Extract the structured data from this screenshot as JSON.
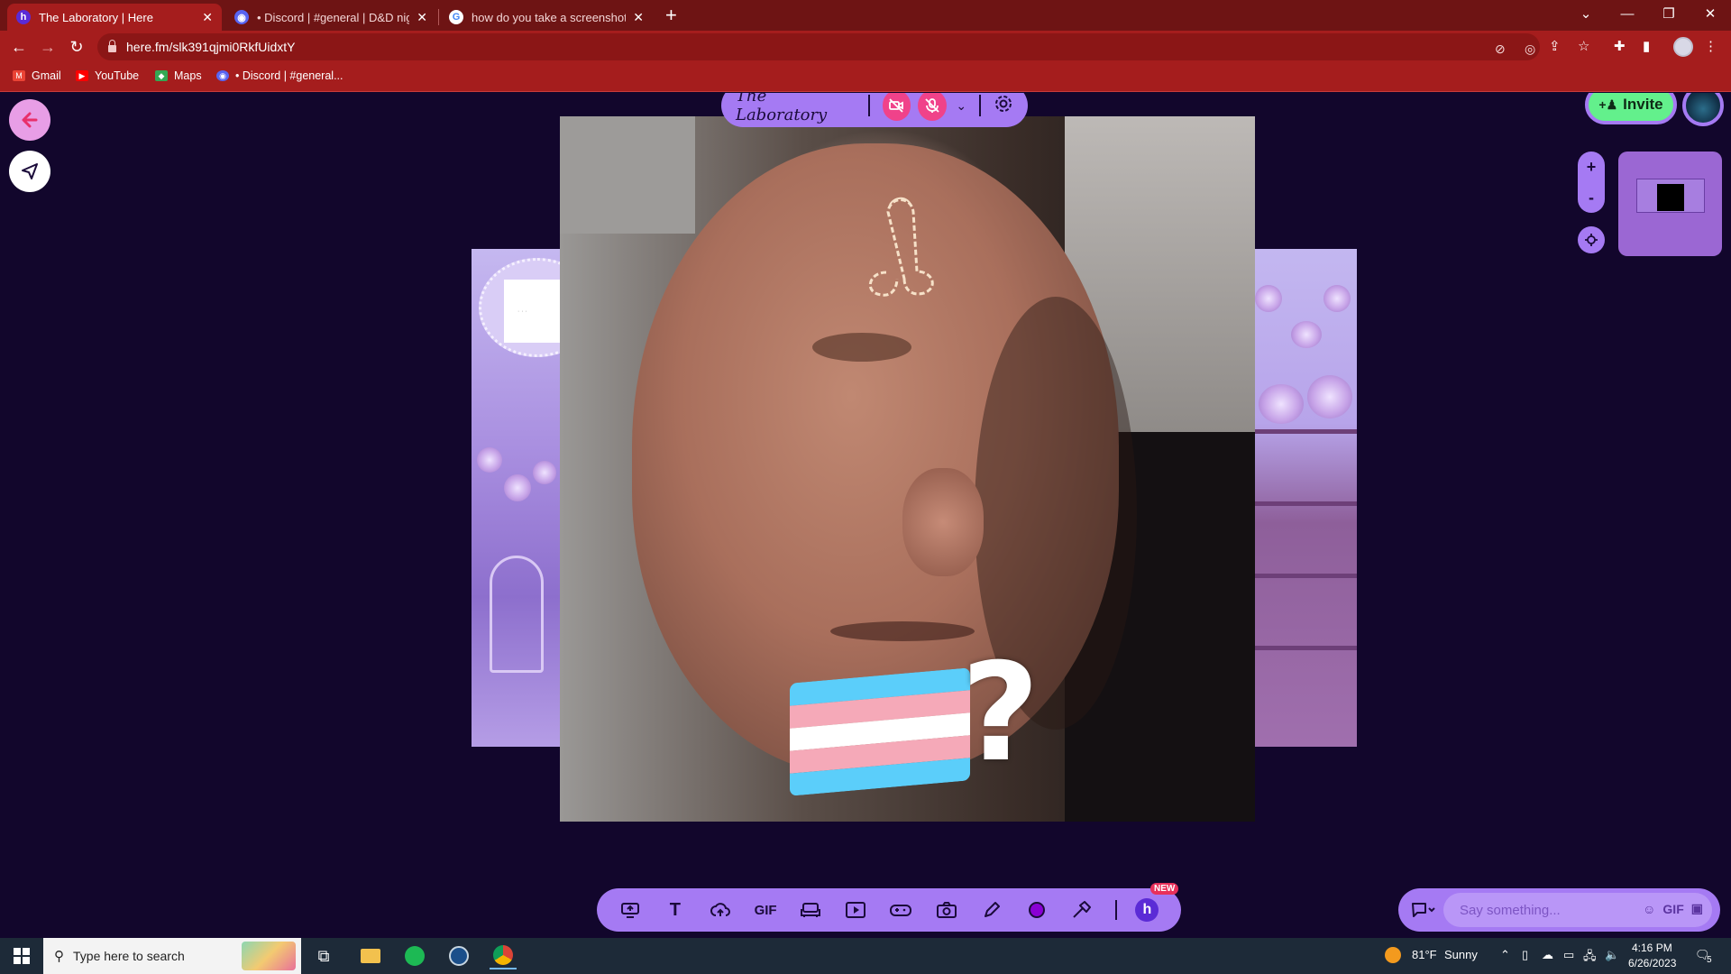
{
  "browser": {
    "tabs": [
      {
        "title": "The Laboratory | Here",
        "favicon": "h",
        "active": true
      },
      {
        "title": "• Discord | #general | D&D night!",
        "favicon": "discord",
        "active": false
      },
      {
        "title": "how do you take a screenshot on",
        "favicon": "google",
        "active": false
      }
    ],
    "url": "here.fm/slk391qjmi0RkfUidxtY",
    "bookmarks": [
      {
        "label": "Gmail",
        "icon": "gmail-icon"
      },
      {
        "label": "YouTube",
        "icon": "youtube-icon"
      },
      {
        "label": "Maps",
        "icon": "maps-icon"
      },
      {
        "label": "• Discord | #general...",
        "icon": "discord-icon"
      }
    ]
  },
  "room": {
    "title": "The Laboratory",
    "invite_label": "Invite",
    "zoom_in": "+",
    "zoom_out": "-"
  },
  "toolbar": {
    "gif_label": "GIF",
    "new_badge": "NEW",
    "items": [
      "screen-share-icon",
      "text-icon",
      "upload-icon",
      "gif",
      "couch-icon",
      "video-icon",
      "game-icon",
      "camera-icon",
      "pencil-icon",
      "shape-icon",
      "hammer-icon"
    ]
  },
  "chat": {
    "placeholder": "Say something...",
    "gif_label": "GIF"
  },
  "taskbar": {
    "search_placeholder": "Type here to search",
    "weather_temp": "81°F",
    "weather_text": "Sunny",
    "time": "4:16 PM",
    "date": "6/26/2023",
    "notifications": "5"
  },
  "colors": {
    "chrome_dark": "#6e1414",
    "chrome": "#a51d1d",
    "app_bg": "#12062c",
    "accent_purple": "#a57af3",
    "pink": "#f0428a",
    "invite_green": "#63f08c"
  }
}
